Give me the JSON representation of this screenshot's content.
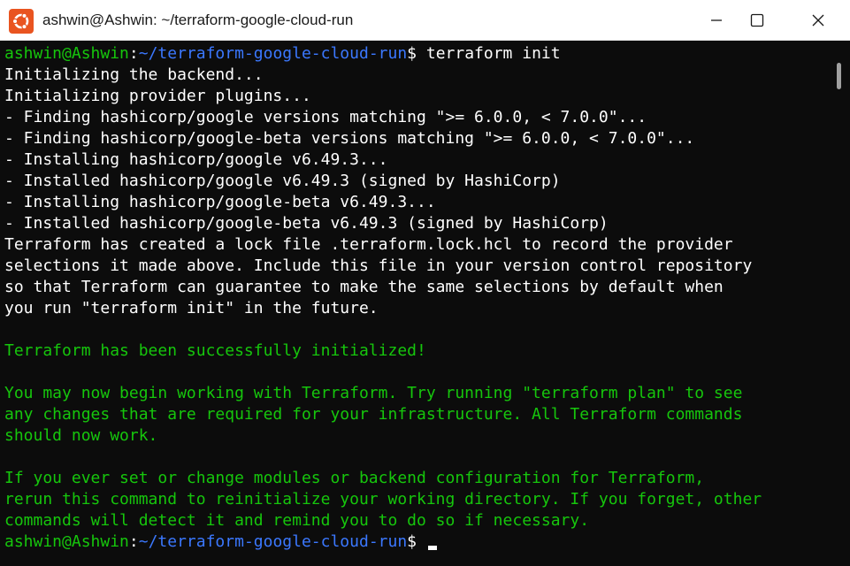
{
  "window": {
    "title": "ashwin@Ashwin: ~/terraform-google-cloud-run",
    "icon": "ubuntu-icon",
    "accent_color": "#e95420",
    "buttons": {
      "minimize": "minimize-icon",
      "maximize": "maximize-icon",
      "close": "close-icon"
    }
  },
  "terminal": {
    "colors": {
      "background": "#0c0c0c",
      "text": "#ffffff",
      "prompt_user": "#16c60c",
      "prompt_path": "#3b78ff",
      "success": "#16c60c"
    },
    "prompt": {
      "user": "ashwin@Ashwin",
      "colon": ":",
      "path": "~/terraform-google-cloud-run",
      "symbol": "$ "
    },
    "command": "terraform init",
    "output": [
      "Initializing the backend...",
      "Initializing provider plugins...",
      "- Finding hashicorp/google versions matching \">= 6.0.0, < 7.0.0\"...",
      "- Finding hashicorp/google-beta versions matching \">= 6.0.0, < 7.0.0\"...",
      "- Installing hashicorp/google v6.49.3...",
      "- Installed hashicorp/google v6.49.3 (signed by HashiCorp)",
      "- Installing hashicorp/google-beta v6.49.3...",
      "- Installed hashicorp/google-beta v6.49.3 (signed by HashiCorp)",
      "Terraform has created a lock file .terraform.lock.hcl to record the provider",
      "selections it made above. Include this file in your version control repository",
      "so that Terraform can guarantee to make the same selections by default when",
      "you run \"terraform init\" in the future."
    ],
    "success_message": "Terraform has been successfully initialized!",
    "next_steps": [
      "You may now begin working with Terraform. Try running \"terraform plan\" to see",
      "any changes that are required for your infrastructure. All Terraform commands",
      "should now work."
    ],
    "reinit_note": [
      "If you ever set or change modules or backend configuration for Terraform,",
      "rerun this command to reinitialize your working directory. If you forget, other",
      "commands will detect it and remind you to do so if necessary."
    ]
  }
}
